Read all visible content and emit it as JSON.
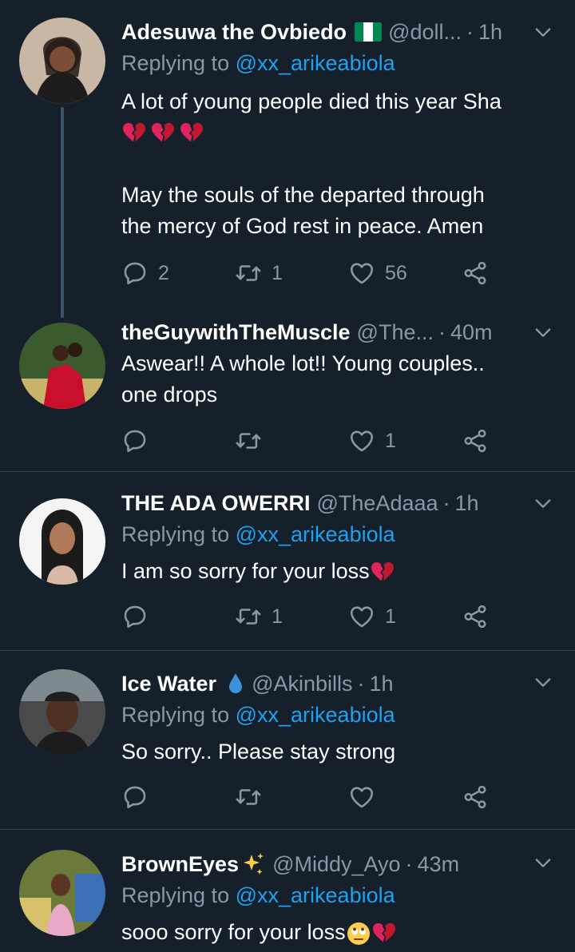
{
  "tweets": [
    {
      "name": "Adesuwa the Ovbiedo",
      "handle": "@doll...",
      "time": "1h",
      "replying_label": "Replying to",
      "replying_to": "@xx_arikeabiola",
      "line1": "A lot of young people died this year Sha",
      "line2": "May the souls of the departed through",
      "line3": "the mercy of God rest in peace. Amen",
      "reply_count": "2",
      "retweet_count": "1",
      "like_count": "56"
    },
    {
      "name": "theGuywithTheMuscle",
      "handle": "@The...",
      "time": "40m",
      "line1": "Aswear!! A whole lot!! Young couples..",
      "line2": "one drops",
      "reply_count": "",
      "retweet_count": "",
      "like_count": "1"
    },
    {
      "name": "THE ADA OWERRI",
      "handle": "@TheAdaaa",
      "time": "1h",
      "replying_label": "Replying to",
      "replying_to": "@xx_arikeabiola",
      "line1": "I am so sorry for your loss",
      "reply_count": "",
      "retweet_count": "1",
      "like_count": "1"
    },
    {
      "name": "Ice Water",
      "handle": "@Akinbills",
      "time": "1h",
      "replying_label": "Replying to",
      "replying_to": "@xx_arikeabiola",
      "line1": "So sorry.. Please stay strong",
      "reply_count": "",
      "retweet_count": "",
      "like_count": ""
    },
    {
      "name": "BrownEyes",
      "handle": "@Middy_Ayo",
      "time": "43m",
      "replying_label": "Replying to",
      "replying_to": "@xx_arikeabiola",
      "line1": "sooo sorry for your loss"
    }
  ],
  "icons": {
    "reply": "reply-icon",
    "retweet": "retweet-icon",
    "like": "heart-icon",
    "share": "share-icon",
    "more": "chevron-down-icon"
  },
  "colors": {
    "background": "#15202b",
    "secondary_text": "#8899a6",
    "link": "#1da1f2",
    "divider": "#38444d",
    "broken_heart": "#e0245e"
  }
}
